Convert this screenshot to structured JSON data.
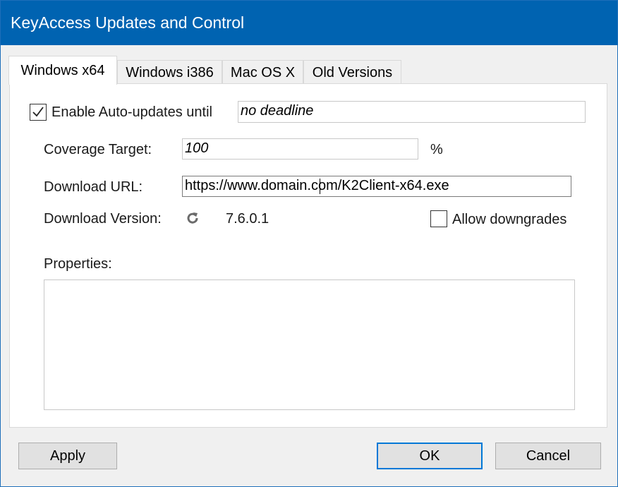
{
  "window": {
    "title": "KeyAccess Updates and Control"
  },
  "tabs": [
    {
      "label": "Windows x64"
    },
    {
      "label": "Windows i386"
    },
    {
      "label": "Mac OS X"
    },
    {
      "label": "Old Versions"
    }
  ],
  "form": {
    "auto_update_label": "Enable Auto-updates until",
    "auto_update_checked": true,
    "deadline_value": "no deadline",
    "coverage_label": "Coverage Target:",
    "coverage_value": "100",
    "coverage_unit": "%",
    "url_label": "Download URL:",
    "url_value": "https://www.domain.com/K2Client-x64.exe",
    "version_label": "Download Version:",
    "version_value": "7.6.0.1",
    "allow_downgrades_label": "Allow downgrades",
    "allow_downgrades_checked": false,
    "properties_label": "Properties:"
  },
  "buttons": {
    "apply": "Apply",
    "ok": "OK",
    "cancel": "Cancel"
  }
}
